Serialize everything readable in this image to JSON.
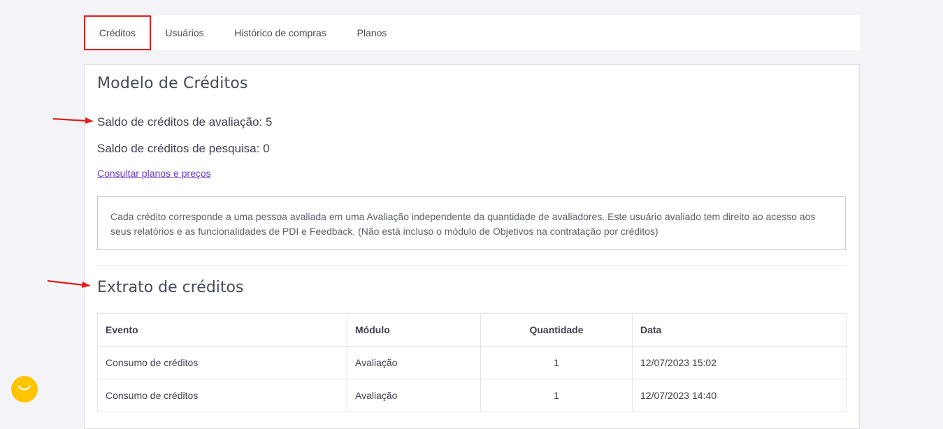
{
  "tabs": [
    {
      "label": "Créditos",
      "active": true
    },
    {
      "label": "Usuários",
      "active": false
    },
    {
      "label": "Histórico de compras",
      "active": false
    },
    {
      "label": "Planos",
      "active": false
    }
  ],
  "main": {
    "title": "Modelo de Créditos",
    "saldo_avaliacao": "Saldo de créditos de avaliação: 5",
    "saldo_pesquisa": "Saldo de créditos de pesquisa: 0",
    "plans_link": "Consultar planos e preços",
    "info_text": "Cada crédito corresponde a uma pessoa avaliada em uma Avaliação independente da quantidade de avaliadores. Este usuário avaliado tem direito ao acesso aos seus relatórios e as funcionalidades de PDI e Feedback. (Não está incluso o módulo de Objetivos na contratação por créditos)",
    "extract_title": "Extrato de créditos"
  },
  "table": {
    "headers": [
      "Evento",
      "Módulo",
      "Quantidade",
      "Data"
    ],
    "rows": [
      [
        "Consumo de créditos",
        "Avaliação",
        "1",
        "12/07/2023 15:02"
      ],
      [
        "Consumo de créditos",
        "Avaliação",
        "1",
        "12/07/2023 14:40"
      ]
    ]
  },
  "colors": {
    "active_tab_outline": "#e0201b",
    "annotation_arrow": "#e0201b",
    "link": "#6a3fc9",
    "chat_button": "#ffc400"
  },
  "icons": {
    "chat": "chat-bubble-icon",
    "annotation": "red-arrow-icon"
  }
}
